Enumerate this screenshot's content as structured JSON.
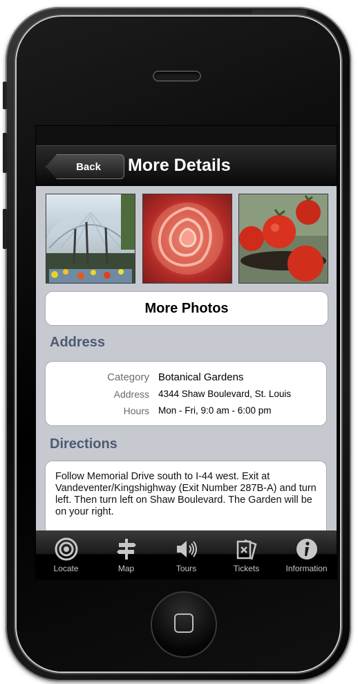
{
  "navbar": {
    "back_label": "Back",
    "title": "More Details"
  },
  "more_photos_label": "More Photos",
  "address_section": {
    "title": "Address",
    "rows": [
      {
        "label": "Category",
        "value": "Botanical Gardens"
      },
      {
        "label": "Address",
        "value": "4344 Shaw Boulevard, St. Louis"
      },
      {
        "label": "Hours",
        "value": "Mon - Fri, 9:0 am - 6:00 pm"
      }
    ]
  },
  "directions_section": {
    "title": "Directions",
    "text": "Follow Memorial Drive south to I-44 west. Exit at Vandeventer/Kingshighway (Exit Number 287B-A) and turn left. Then turn left on Shaw Boulevard. The Garden will be on your right."
  },
  "tabbar": {
    "items": [
      {
        "label": "Locate",
        "icon": "target-icon"
      },
      {
        "label": "Map",
        "icon": "signpost-icon"
      },
      {
        "label": "Tours",
        "icon": "speaker-icon"
      },
      {
        "label": "Tickets",
        "icon": "tickets-icon"
      },
      {
        "label": "Information",
        "icon": "info-icon"
      }
    ]
  }
}
